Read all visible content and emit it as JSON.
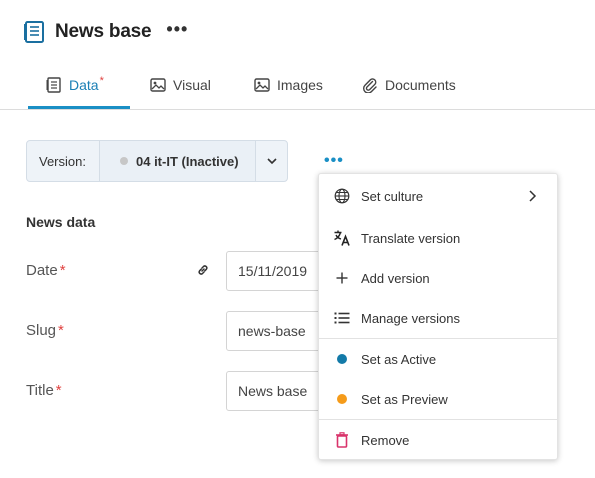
{
  "header": {
    "title": "News base",
    "more_label": "•••"
  },
  "tabs": [
    {
      "label": "Data",
      "required_mark": "*",
      "active": true,
      "icon": "data-icon"
    },
    {
      "label": "Visual",
      "active": false,
      "icon": "visual-icon"
    },
    {
      "label": "Images",
      "active": false,
      "icon": "images-icon"
    },
    {
      "label": "Documents",
      "active": false,
      "icon": "paperclip-icon"
    }
  ],
  "version": {
    "label": "Version:",
    "value": "04 it-IT (Inactive)",
    "more_label": "•••"
  },
  "news_data": {
    "section_title": "News data",
    "required_mark": "*",
    "fields": [
      {
        "label": "Date",
        "value": "15/11/2019"
      },
      {
        "label": "Slug",
        "value": "news-base"
      },
      {
        "label": "Title",
        "value": "News base"
      }
    ]
  },
  "menu": {
    "items": [
      {
        "label": "Set culture",
        "icon": "globe-icon"
      },
      {
        "label": "Translate version",
        "icon": "translate-icon"
      },
      {
        "label": "Add version",
        "icon": "plus-icon"
      },
      {
        "label": "Manage versions",
        "icon": "list-icon"
      },
      {
        "label": "Set as Active",
        "icon": "active-dot-icon"
      },
      {
        "label": "Set as Preview",
        "icon": "preview-dot-icon"
      },
      {
        "label": "Remove",
        "icon": "trash-icon"
      }
    ]
  },
  "colors": {
    "accent": "#1a8fc5",
    "required": "#e0413f",
    "active_dot": "#137aa8",
    "preview_dot": "#f59b1a",
    "remove_icon": "#d9336b",
    "inactive_dot": "#c7c7c7"
  }
}
